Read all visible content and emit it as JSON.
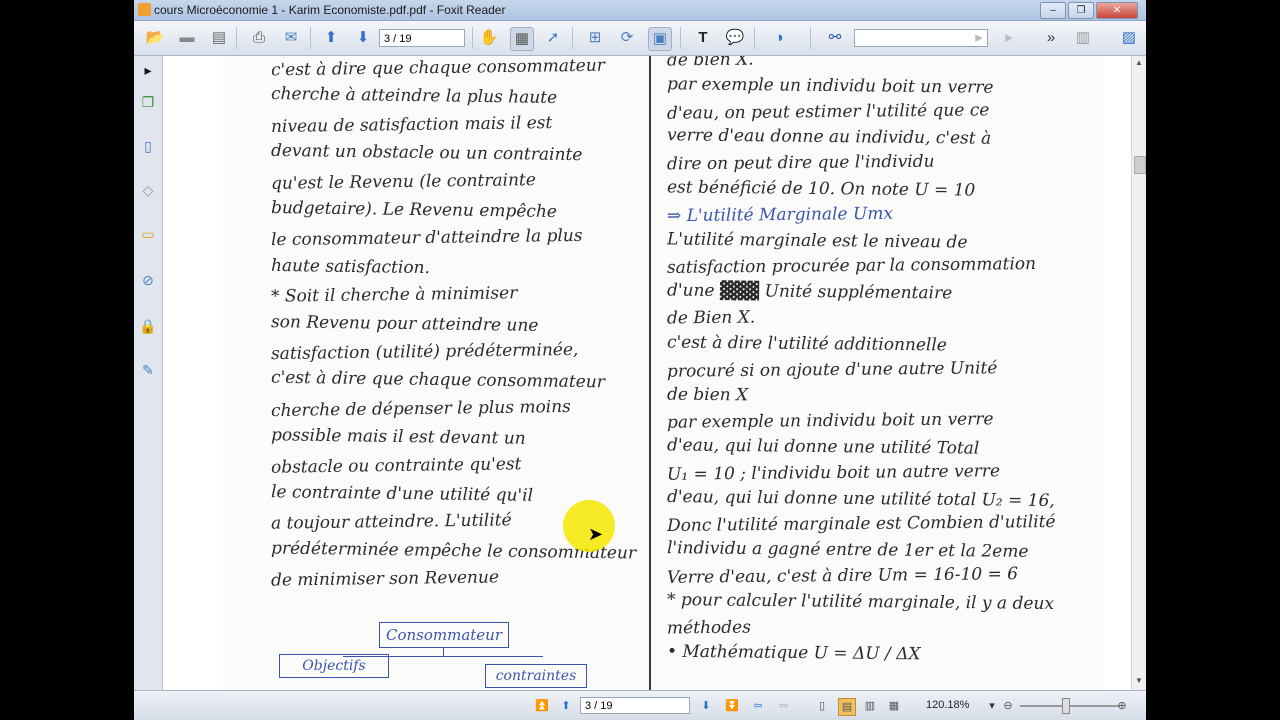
{
  "window": {
    "title": "cours Microéconomie 1 - Karim Economiste.pdf.pdf - Foxit Reader"
  },
  "toolbar": {
    "page_field": "3 / 19"
  },
  "status": {
    "page_field": "3 / 19",
    "zoom": "120.18%"
  },
  "document": {
    "left_lines": [
      "c'est à dire que chaque consommateur",
      "cherche à atteindre la plus haute",
      "niveau de satisfaction mais il est",
      "devant un obstacle ou un contrainte",
      "qu'est le Revenu (le contrainte",
      "budgetaire). Le Revenu empêche",
      "le consommateur d'atteindre la plus",
      "haute satisfaction.",
      "* Soit il cherche à minimiser",
      "son Revenu pour atteindre une",
      "satisfaction (utilité) prédéterminée,",
      "c'est à dire que chaque consommateur",
      "cherche de dépenser le plus moins",
      "possible mais il est devant un",
      "obstacle ou contrainte qu'est",
      "le contrainte d'une utilité qu'il",
      "a toujour atteindre. L'utilité",
      "prédéterminée empêche le consommateur",
      "de minimiser son Revenue"
    ],
    "diagram": {
      "top": "Consommateur",
      "left": "Objectifs",
      "right": "contraintes"
    },
    "right_lines": [
      "de bien X.",
      "par exemple un individu boit un verre",
      "d'eau, on peut estimer l'utilité que ce",
      "verre d'eau donne au individu, c'est à",
      "dire on peut dire que l'individu",
      "est bénéficié de 10. On note U = 10",
      "⇒ L'utilité Marginale Umx",
      "L'utilité marginale est le niveau de",
      "satisfaction procurée par la consommation",
      "d'une ▓▓▓ Unité supplémentaire",
      "de Bien X.",
      "c'est à dire l'utilité additionnelle",
      "procuré si on ajoute d'une autre Unité",
      "de bien X",
      "par exemple un individu boit un verre",
      "d'eau, qui lui donne une utilité Total",
      "U₁ = 10 ; l'individu boit un autre verre",
      "d'eau, qui lui donne une utilité total U₂ = 16,",
      "Donc l'utilité marginale est Combien d'utilité",
      "l'individu a gagné entre de 1er et la 2eme",
      "Verre d'eau, c'est à dire Um = 16-10 = 6",
      "* pour calculer l'utilité marginale, il y a deux",
      "méthodes",
      "• Mathématique  U = ΔU / ΔX"
    ]
  },
  "colors": {
    "highlight": "#f5e600",
    "ink": "#2b2b2b",
    "blue_ink": "#3a55b0"
  },
  "icons": [
    "folder-open-icon",
    "save-icon",
    "print-icon",
    "prev-page-icon",
    "next-page-icon",
    "hand-tool-icon",
    "select-text-icon",
    "zoom-icon",
    "binoculars-icon"
  ]
}
